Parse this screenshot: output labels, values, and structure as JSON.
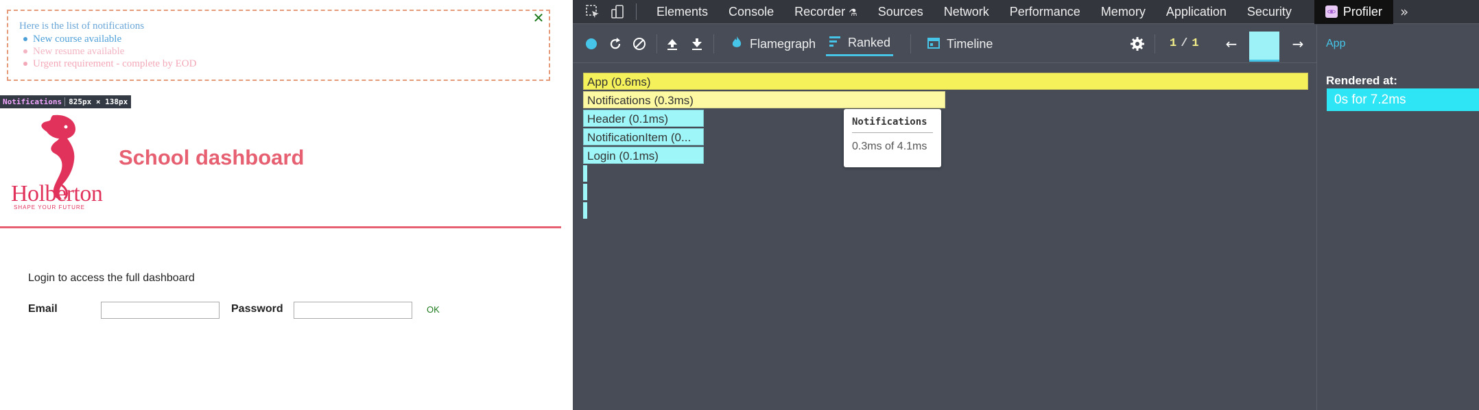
{
  "app": {
    "notifications": {
      "title": "Here is the list of notifications",
      "items": [
        "New course available",
        "New resume available",
        "Urgent requirement - complete by EOD"
      ],
      "close_icon": "close-icon"
    },
    "inspect_tag": {
      "name": "Notifications",
      "dimensions": "825px × 138px"
    },
    "header": {
      "logo_text": "Holberton",
      "logo_sub": "SHAPE YOUR FUTURE",
      "title": "School dashboard",
      "accent_color": "#e66072"
    },
    "login": {
      "prompt": "Login to access the full dashboard",
      "email_label": "Email",
      "password_label": "Password",
      "ok_label": "OK"
    }
  },
  "devtools": {
    "tabs": [
      "Elements",
      "Console",
      "Recorder",
      "Sources",
      "Network",
      "Performance",
      "Memory",
      "Application",
      "Security"
    ],
    "active_tab": "Profiler",
    "views": {
      "flamegraph": "Flamegraph",
      "ranked": "Ranked",
      "timeline": "Timeline"
    },
    "commit": {
      "current": "1",
      "total": "1"
    },
    "ranked_bars": [
      {
        "label": "App (0.6ms)",
        "color": "yellow"
      },
      {
        "label": "Notifications (0.3ms)",
        "color": "light-yellow"
      },
      {
        "label": "Header (0.1ms)",
        "color": "cyan"
      },
      {
        "label": "NotificationItem (0...",
        "color": "cyan"
      },
      {
        "label": "Login (0.1ms)",
        "color": "cyan"
      }
    ],
    "tooltip": {
      "title": "Notifications",
      "value": "0.3ms of 4.1ms"
    },
    "sidebar": {
      "title": "App",
      "rendered_at_label": "Rendered at:",
      "rendered_at_value": "0s for 7.2ms"
    }
  }
}
